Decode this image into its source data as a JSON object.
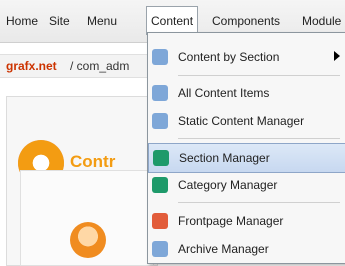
{
  "menubar": {
    "items": [
      "Home",
      "Site",
      "Menu",
      "Content",
      "Components",
      "Module"
    ]
  },
  "breadcrumb": {
    "brand": "grafx.net",
    "path": "/ com_adm"
  },
  "panel": {
    "title": "Contr"
  },
  "dropdown": {
    "items": [
      {
        "label": "Content by Section",
        "icon": "content-icon",
        "submenu": true
      },
      {
        "label": "All Content Items",
        "icon": "content-items-icon"
      },
      {
        "label": "Static Content Manager",
        "icon": "static-content-icon"
      },
      {
        "label": "Section Manager",
        "icon": "section-manager-icon",
        "hover": true
      },
      {
        "label": "Category Manager",
        "icon": "category-manager-icon"
      },
      {
        "label": "Frontpage Manager",
        "icon": "frontpage-manager-icon"
      },
      {
        "label": "Archive Manager",
        "icon": "archive-manager-icon"
      }
    ]
  },
  "colors": {
    "brand": "#cc3300",
    "accent": "#f39c12",
    "hover_bg": "#c7d8f0"
  }
}
